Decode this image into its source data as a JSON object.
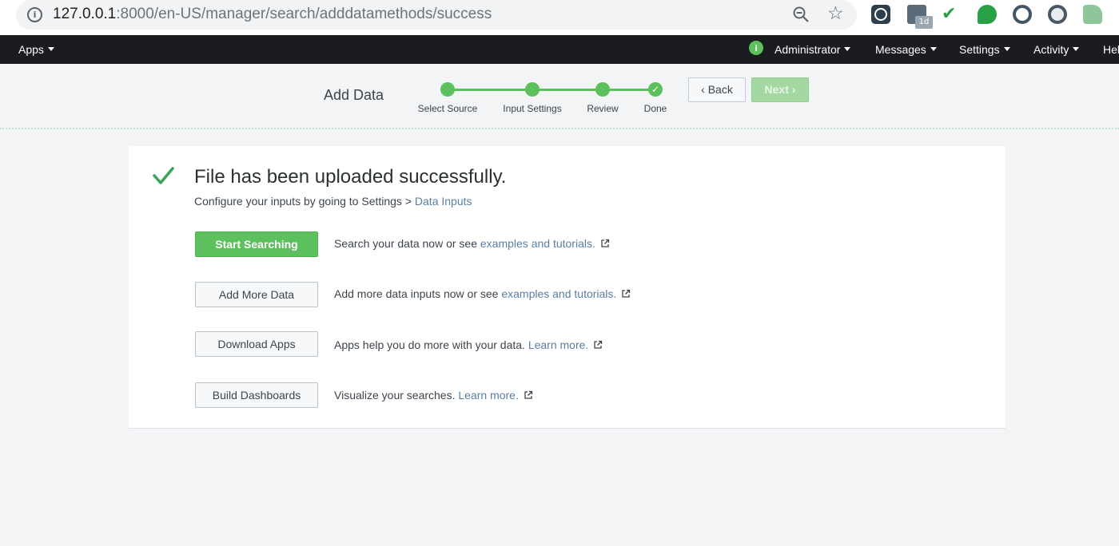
{
  "browser": {
    "url_host": "127.0.0.1",
    "url_path": ":8000/en-US/manager/search/adddatamethods/success",
    "calendar_badge": "1d"
  },
  "nav": {
    "apps_label": "Apps",
    "administrator_label": "Administrator",
    "messages_label": "Messages",
    "settings_label": "Settings",
    "activity_label": "Activity",
    "help_label": "Help"
  },
  "wizard": {
    "title": "Add Data",
    "steps": [
      {
        "label": "Select Source",
        "state": "complete"
      },
      {
        "label": "Input Settings",
        "state": "complete"
      },
      {
        "label": "Review",
        "state": "complete"
      },
      {
        "label": "Done",
        "state": "current-complete"
      }
    ],
    "back_label": "Back",
    "next_label": "Next"
  },
  "success": {
    "title": "File has been uploaded successfully.",
    "subtitle_prefix": "Configure your inputs by going to Settings > ",
    "subtitle_link": "Data Inputs"
  },
  "actions": [
    {
      "button": "Start Searching",
      "text": "Search your data now or see ",
      "link": "examples and tutorials."
    },
    {
      "button": "Add More Data",
      "text": "Add more data inputs now or see ",
      "link": "examples and tutorials."
    },
    {
      "button": "Download Apps",
      "text": "Apps help you do more with your data. ",
      "link": "Learn more."
    },
    {
      "button": "Build Dashboards",
      "text": "Visualize your searches. ",
      "link": "Learn more."
    }
  ],
  "colors": {
    "accent_green": "#5cc05c",
    "nav_bg": "#1a1c20",
    "link": "#5a7fa5"
  }
}
